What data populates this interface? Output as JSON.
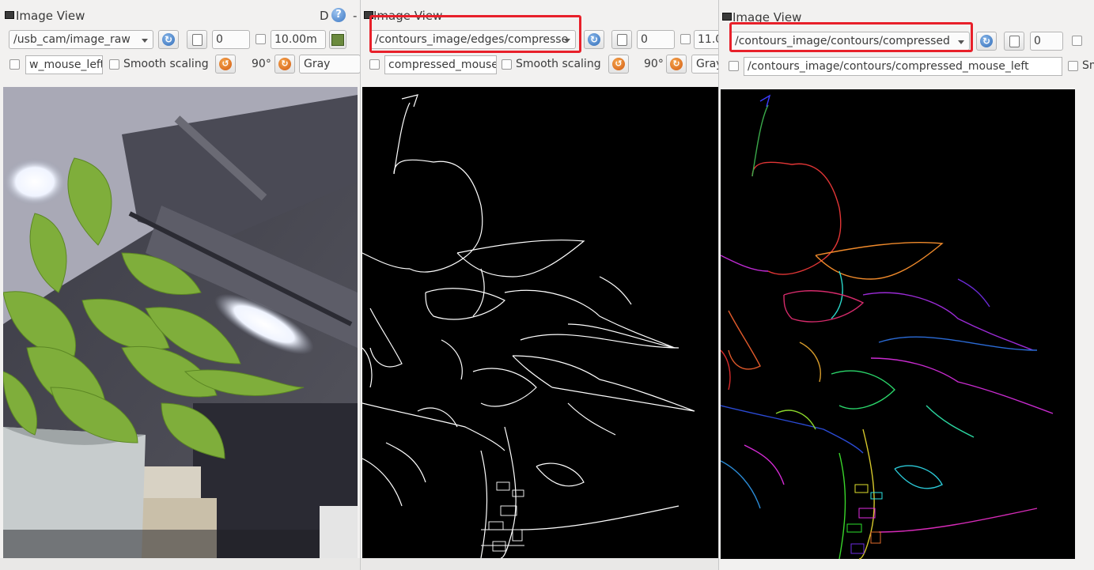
{
  "panels": [
    {
      "title": "Image View",
      "d_label": "D",
      "help": "?",
      "topic": "/usb_cam/image_raw",
      "spin_value": "0",
      "rate": "10.00m",
      "mouse_topic": "w_mouse_left",
      "smooth_scaling_label": "Smooth scaling",
      "rotation": "90°",
      "color_mode": "Gray"
    },
    {
      "title": "Image View",
      "topic": "/contours_image/edges/compresse",
      "spin_value": "0",
      "rate": "11.0",
      "mouse_topic": "compressed_mouse_",
      "smooth_scaling_label": "Smooth scaling",
      "rotation": "90°",
      "color_mode": "Gray"
    },
    {
      "title": "Image View",
      "topic": "/contours_image/contours/compressed",
      "spin_value": "0",
      "mouse_topic": "/contours_image/contours/compressed_mouse_left",
      "smooth_scaling_partial": "Sm"
    }
  ],
  "separator": "-",
  "colors": {
    "highlight": "#e8202a",
    "panel_bg": "#f2f1f0",
    "canvas_bg": "#000000"
  }
}
